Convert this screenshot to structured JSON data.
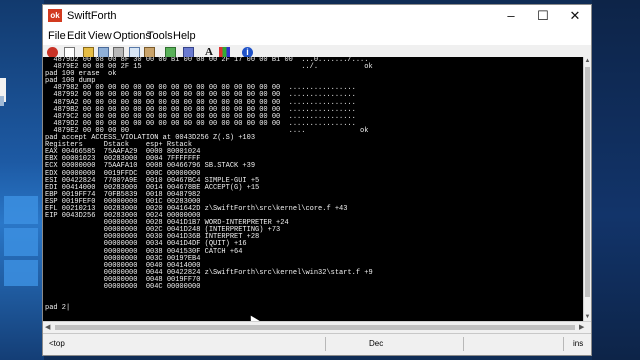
{
  "window": {
    "title": "SwiftForth",
    "app_icon_text": "ok",
    "controls": {
      "minimize": "–",
      "maximize": "☐",
      "close": "✕"
    }
  },
  "menu": [
    "File",
    "Edit",
    "View",
    "Options",
    "Tools",
    "Help"
  ],
  "toolbar": [
    {
      "name": "stop-icon"
    },
    {
      "name": "new-file-icon"
    },
    {
      "name": "open-folder-icon"
    },
    {
      "name": "cut-icon"
    },
    {
      "name": "print-icon"
    },
    {
      "name": "copy-icon"
    },
    {
      "name": "paste-icon"
    },
    {
      "name": "tool-icon"
    },
    {
      "name": "tool-icon"
    },
    {
      "name": "font-icon",
      "text": "A"
    },
    {
      "name": "color-icon"
    },
    {
      "name": "info-icon",
      "text": "i"
    }
  ],
  "console": {
    "lines": [
      "  4879D2 00 08 00 8F 30 00 00 B1 00 08 00 2F 17 00 00 B1 00  ...0......./.... ",
      "  4879E2 00 08 00 2F 15                                      ../.           ok",
      "pad 100 erase  ok",
      "pad 100 dump",
      "  487982 00 00 00 00 00 00 00 00 00 00 00 00 00 00 00 00  ................",
      "  487992 00 00 00 00 00 00 00 00 00 00 00 00 00 00 00 00  ................",
      "  4879A2 00 00 00 00 00 00 00 00 00 00 00 00 00 00 00 00  ................",
      "  4879B2 00 00 00 00 00 00 00 00 00 00 00 00 00 00 00 00  ................",
      "  4879C2 00 00 00 00 00 00 00 00 00 00 00 00 00 00 00 00  ................",
      "  4879D2 00 00 00 00 00 00 00 00 00 00 00 00 00 00 00 00  ................",
      "  4879E2 00 00 00 00                                      ....             ok",
      "pad accept ACCESS_VIOLATION at 0043D256 Z(.S) +103",
      "Registers     Dstack    esp+ Rstack",
      "EAX 00466585  75AAFA29  0000 80001024",
      "EBX 00001023  00283000  0004 7FFFFFFF",
      "ECX 00000000  75AAFA10  0008 00466796 SB.STACK +39",
      "EDX 00000000  0019FFDC  000C 00000000",
      "ESI 00422824  7700?A9E  0010 00467BC4 SIMPLE-GUI +5",
      "EDI 00414000  00283000  0014 004678BE ACCEPT(G) +15",
      "EBP 0019FF74  70FB5839  0018 00487982",
      "ESP 0019FEF0  00000000  001C 00283000",
      "EFL 00210213  00283000  0020 0041642D z\\SwiftForth\\src\\kernel\\core.f +43",
      "EIP 0043D256  00283000  0024 00000000",
      "              00000000  0028 0041D1B7 WORD-INTERPRETER +24",
      "              00000000  002C 0041D248 (INTERPRETING) +73",
      "              00000000  0030 0041D36B INTERPRET +28",
      "              00000000  0034 0041D4DF (QUIT) +16",
      "              00000000  0038 0041530F CATCH +64",
      "              00000000  003C 0019?EB4",
      "              00000000  0040 00414000",
      "              00000000  0044 00422824 z\\SwiftForth\\src\\kernel\\win32\\start.f +9",
      "              00000000  0048 0019FF70",
      "              00000000  004C 00000000",
      "",
      "",
      "pad 2|"
    ]
  },
  "statusbar": [
    "<top",
    "Dec",
    "ins"
  ]
}
